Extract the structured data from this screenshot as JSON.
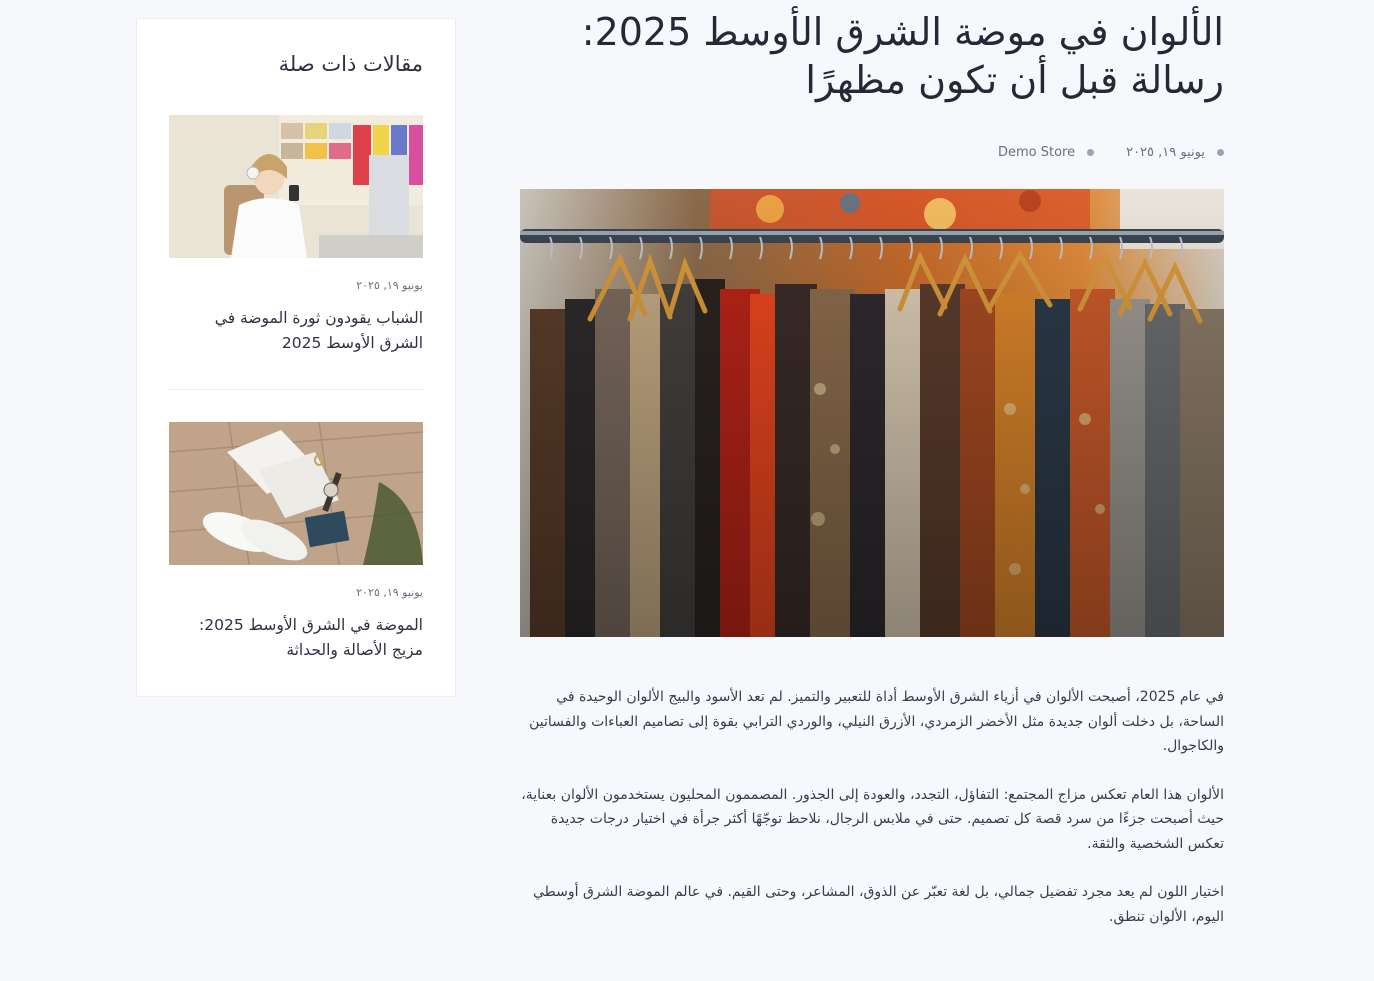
{
  "article": {
    "title_line1": "الألوان في موضة الشرق الأوسط 2025:",
    "title_line2": "رسالة قبل أن تكون مظهرًا",
    "date": "يونيو ١٩, ٢٠٢٥",
    "author": "Demo Store",
    "paragraphs": [
      "في عام 2025، أصبحت الألوان في أزياء الشرق الأوسط أداة للتعبير والتميز. لم تعد الأسود والبيج الألوان الوحيدة في الساحة، بل دخلت ألوان جديدة مثل الأخضر الزمردي، الأزرق النيلي، والوردي الترابي بقوة إلى تصاميم العباءات والفساتين والكاجوال.",
      "الألوان هذا العام تعكس مزاج المجتمع: التفاؤل، التجدد، والعودة إلى الجذور. المصممون المحليون يستخدمون الألوان بعناية، حيث أصبحت جزءًا من سرد قصة كل تصميم. حتى في ملابس الرجال، نلاحظ توجّهًا أكثر جرأة في اختيار درجات جديدة تعكس الشخصية والثقة.",
      "اختيار اللون لم يعد مجرد تفضيل جمالي، بل لغة تعبّر عن الذوق، المشاعر، وحتى القيم. في عالم الموضة الشرق أوسطي اليوم، الألوان تنطق."
    ]
  },
  "sidebar": {
    "title": "مقالات ذات صلة",
    "items": [
      {
        "date": "يونيو ١٩, ٢٠٢٥",
        "title": "الشباب يقودون ثورة الموضة في الشرق الأوسط 2025"
      },
      {
        "date": "يونيو ١٩, ٢٠٢٥",
        "title": "الموضة في الشرق الأوسط 2025: مزيج الأصالة والحداثة"
      }
    ]
  },
  "colors": {
    "background": "#f7f8fb",
    "card": "#ffffff",
    "text": "#2f3140",
    "muted": "#6c6f80",
    "dot": "#9fa2b1"
  }
}
